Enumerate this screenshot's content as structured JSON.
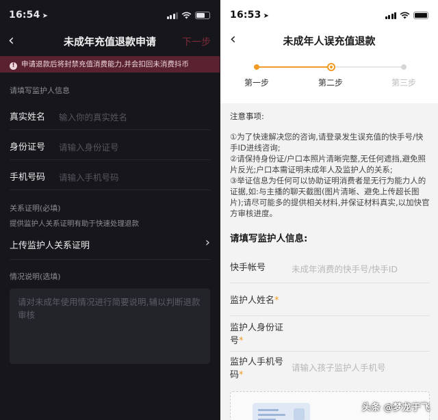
{
  "left": {
    "status_time": "16:54",
    "nav": {
      "back": "‹",
      "title": "未成年充值退款申请",
      "next": "下一步"
    },
    "banner": "申请退款后将封禁充值消费能力,并会扣回未消费抖币",
    "section_guardian": "请填写监护人信息",
    "fields": [
      {
        "label": "真实姓名",
        "placeholder": "输入你的真实姓名"
      },
      {
        "label": "身份证号",
        "placeholder": "请输入身份证号"
      },
      {
        "label": "手机号码",
        "placeholder": "请输入手机号码"
      }
    ],
    "relation_title": "关系证明(必填)",
    "relation_hint": "提供监护人关系证明有助于快速处理退款",
    "upload_label": "上传监护人关系证明",
    "situation_title": "情况说明(选填)",
    "situation_placeholder": "请对未成年使用情况进行简要说明,辅以判断退款审核"
  },
  "right": {
    "status_time": "16:53",
    "nav": {
      "back": "‹",
      "title": "未成年人误充值退款"
    },
    "steps": [
      "第一步",
      "第二步",
      "第三步"
    ],
    "current_step": 2,
    "notes_title": "注意事项:",
    "notes": [
      "①为了快速解决您的咨询,请登录发生误充值的快手号/快手ID进线咨询;",
      "②请保持身份证/户口本照片清晰完整,无任何遮挡,避免照片反光;户口本需证明未成年人及监护人的关系;",
      "③举证信息为任何可以协助证明消费者是无行为能力人的证据,如:与主播的聊天截图(图片清晰、避免上传超长图片);请尽可能多的提供相关材料,并保证材料真实,以加快官方审核进度。"
    ],
    "guardian_title": "请填写监护人信息:",
    "fields": [
      {
        "label": "快手帐号",
        "required": "",
        "placeholder": "未成年消费的快手号/快手ID"
      },
      {
        "label": "监护人姓名",
        "required": "*",
        "placeholder": ""
      },
      {
        "label": "监护人身份证号",
        "required": "*",
        "placeholder": ""
      },
      {
        "label": "监护人手机号码",
        "required": "*",
        "placeholder": "请输入孩子监护人手机号"
      }
    ],
    "upload_plus": "+"
  },
  "watermark": "头条 @梦龙于飞",
  "colors": {
    "accent_orange": "#f19a24",
    "dark_bg": "#16161b",
    "banner_bg": "#5a2230",
    "next_disabled": "#7d2a3a"
  },
  "icons": [
    "location-arrow-icon",
    "signal-icon",
    "wifi-icon",
    "battery-icon",
    "back-chevron-icon",
    "exclamation-icon",
    "chevron-right-icon"
  ]
}
